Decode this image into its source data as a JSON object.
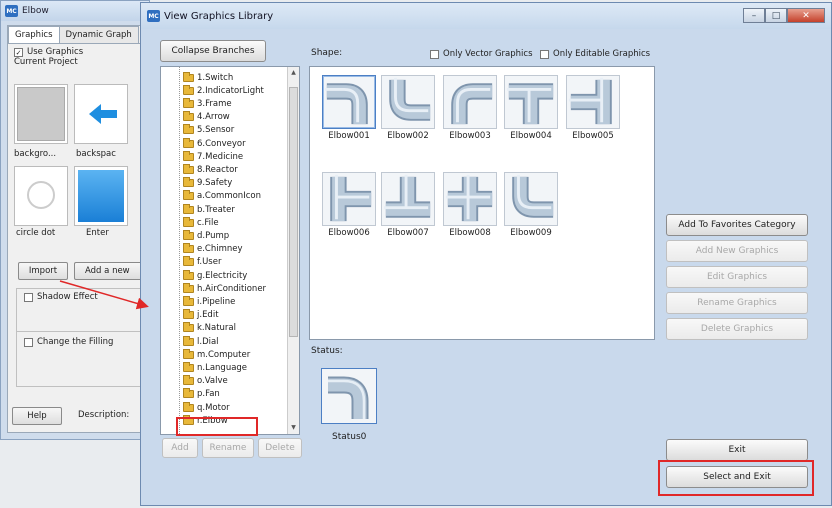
{
  "background_window": {
    "title": "Elbow",
    "tabs": [
      {
        "label": "Graphics"
      },
      {
        "label": "Dynamic Graph"
      }
    ],
    "use_graphics_label": "Use Graphics",
    "current_project_label": "Current Project",
    "thumbnails": [
      {
        "label": "backgro..."
      },
      {
        "label": "backspac"
      },
      {
        "label": "circle dot"
      },
      {
        "label": "Enter"
      }
    ],
    "import_label": "Import",
    "add_new_label": "Add a new",
    "shadow_label": "Shadow Effect",
    "change_fill_label": "Change the Filling",
    "help_label": "Help",
    "description_label": "Description:"
  },
  "dialog": {
    "title": "View Graphics Library",
    "collapse_label": "Collapse Branches",
    "shape_label": "Shape:",
    "only_vector_label": "Only Vector Graphics",
    "only_editable_label": "Only Editable Graphics",
    "status_label": "Status:",
    "status_item_label": "Status0",
    "tree_items": [
      {
        "label": "1.Switch"
      },
      {
        "label": "2.IndicatorLight"
      },
      {
        "label": "3.Frame"
      },
      {
        "label": "4.Arrow"
      },
      {
        "label": "5.Sensor"
      },
      {
        "label": "6.Conveyor"
      },
      {
        "label": "7.Medicine"
      },
      {
        "label": "8.Reactor"
      },
      {
        "label": "9.Safety"
      },
      {
        "label": "a.CommonIcon"
      },
      {
        "label": "b.Treater"
      },
      {
        "label": "c.File"
      },
      {
        "label": "d.Pump"
      },
      {
        "label": "e.Chimney"
      },
      {
        "label": "f.User"
      },
      {
        "label": "g.Electricity"
      },
      {
        "label": "h.AirConditioner"
      },
      {
        "label": "i.Pipeline"
      },
      {
        "label": "j.Edit"
      },
      {
        "label": "k.Natural"
      },
      {
        "label": "l.Dial"
      },
      {
        "label": "m.Computer"
      },
      {
        "label": "n.Language"
      },
      {
        "label": "o.Valve"
      },
      {
        "label": "p.Fan"
      },
      {
        "label": "q.Motor"
      },
      {
        "label": "r.Elbow"
      }
    ],
    "shapes": [
      {
        "label": "Elbow001"
      },
      {
        "label": "Elbow002"
      },
      {
        "label": "Elbow003"
      },
      {
        "label": "Elbow004"
      },
      {
        "label": "Elbow005"
      },
      {
        "label": "Elbow006"
      },
      {
        "label": "Elbow007"
      },
      {
        "label": "Elbow008"
      },
      {
        "label": "Elbow009"
      }
    ],
    "tree_buttons": {
      "add": "Add",
      "rename": "Rename",
      "delete": "Delete"
    },
    "side_buttons": {
      "add_favorites": "Add To Favorites Category",
      "add_new": "Add New Graphics",
      "edit": "Edit Graphics",
      "rename": "Rename Graphics",
      "delete": "Delete Graphics"
    },
    "exit_label": "Exit",
    "select_exit_label": "Select and Exit",
    "app_icon_text": "MC"
  },
  "colors": {
    "highlight_red": "#e02828",
    "pipe_fill": "#a9bccf",
    "selection_blue": "#4c7fc4"
  }
}
